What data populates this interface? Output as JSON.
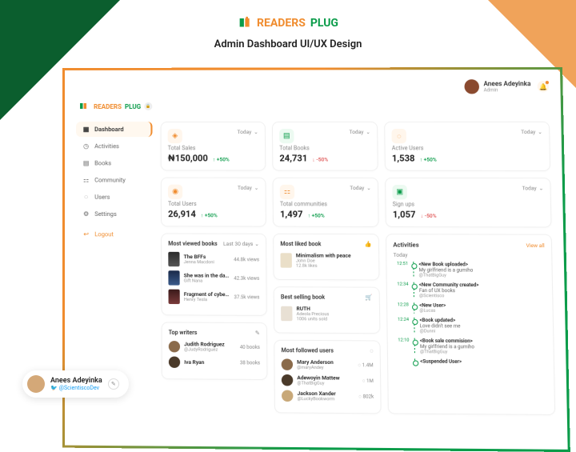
{
  "brand": {
    "readers": "READERS",
    "plug": "PLUG"
  },
  "subtitle": "Admin Dashboard UI/UX Design",
  "topbar": {
    "user_name": "Anees Adeyinka",
    "user_role": "Admin"
  },
  "nav": {
    "dashboard": "Dashboard",
    "activities": "Activities",
    "books": "Books",
    "community": "Community",
    "users": "Users",
    "settings": "Settings",
    "logout": "Logout"
  },
  "period": {
    "today": "Today",
    "last30": "Last 30 days"
  },
  "kpi": {
    "sales": {
      "title": "Total Sales",
      "value": "₦150,000",
      "pct": "+50%"
    },
    "users": {
      "title": "Total Users",
      "value": "26,914",
      "pct": "+50%"
    },
    "books": {
      "title": "Total Books",
      "value": "24,731",
      "pct": "-50%"
    },
    "communities": {
      "title": "Total communities",
      "value": "1,497",
      "pct": "+50%"
    },
    "active": {
      "title": "Active Users",
      "value": "1,538",
      "pct": "+50%"
    },
    "signups": {
      "title": "Sign ups",
      "value": "1,057",
      "pct": "-50%"
    }
  },
  "mvb": {
    "title": "Most viewed books",
    "items": [
      {
        "t": "The BFFs",
        "s": "Jenna Macdoni",
        "v": "44.8k views"
      },
      {
        "t": "She was in the dark",
        "s": "Gift Nana",
        "v": "42.3k views"
      },
      {
        "t": "Fragment of cyber crimes",
        "s": "Henry Tesla",
        "v": "37.5k views"
      }
    ]
  },
  "tw": {
    "title": "Top writers",
    "items": [
      {
        "t": "Judith Rodriguez",
        "s": "@JudyRodriguez",
        "v": "40 books"
      },
      {
        "t": "Iva Ryan",
        "s": "",
        "v": "38 books"
      }
    ]
  },
  "mlb": {
    "title": "Most liked book",
    "t": "Minimalism with peace",
    "s": "John Doe",
    "v": "12.8k likes"
  },
  "bsb": {
    "title": "Best selling book",
    "t": "RUTH",
    "s": "Adeola Precious",
    "v": "1006 units sold"
  },
  "mfu": {
    "title": "Most followed users",
    "items": [
      {
        "t": "Mary Anderson",
        "s": "@maryAndey",
        "v": "1.4M"
      },
      {
        "t": "Adewoyin Mattew",
        "s": "@ThatBigGuy",
        "v": "1M"
      },
      {
        "t": "Jackson Xander",
        "s": "@LuckyBookworm",
        "v": "802k"
      }
    ]
  },
  "activities": {
    "title": "Activities",
    "viewall": "View all",
    "today": "Today",
    "items": [
      {
        "time": "12:51",
        "ev": "<New Book uploaded>",
        "d": "My girlfriend is a gumiho",
        "u": "@ThatBigGuy"
      },
      {
        "time": "12:34",
        "ev": "<New Community created>",
        "d": "Fan of UX books",
        "u": "@Scientisco"
      },
      {
        "time": "12:28",
        "ev": "<New User>",
        "d": "",
        "u": "@Lucas"
      },
      {
        "time": "12:24",
        "ev": "<Book updated>",
        "d": "Love didn't see me",
        "u": "@Dunni"
      },
      {
        "time": "12:10",
        "ev": "<Book sale commision>",
        "d": "My girlfriend is a gumiho",
        "u": "@ThatBigGuy"
      },
      {
        "time": "",
        "ev": "<Suspended User>",
        "d": "",
        "u": ""
      }
    ]
  },
  "credit": {
    "name": "Anees Adeyinka",
    "handle": "@ScientiscoDev"
  }
}
